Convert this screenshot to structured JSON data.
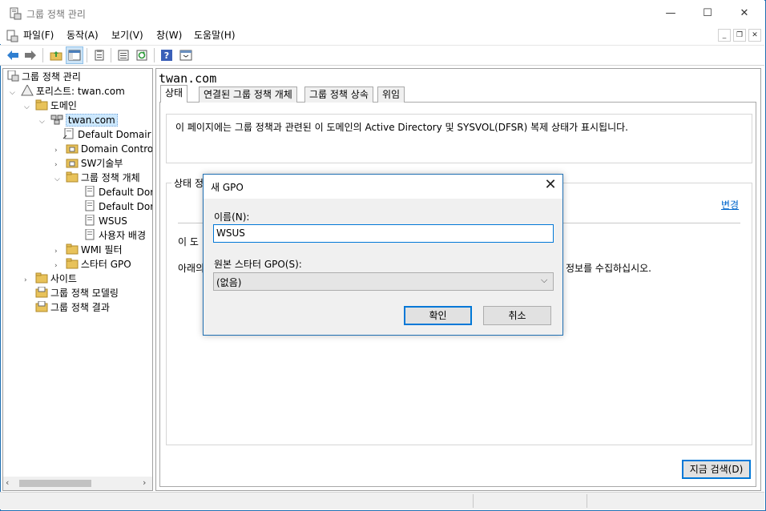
{
  "window": {
    "title": "그룹 정책 관리",
    "minimize": "—",
    "maximize": "☐",
    "close": "✕"
  },
  "menu": {
    "items": [
      "파일(F)",
      "동작(A)",
      "보기(V)",
      "창(W)",
      "도움말(H)"
    ]
  },
  "toolbar": {
    "icons": [
      "back-arrow-icon",
      "forward-arrow-icon",
      "up-folder-icon",
      "show-hide-tree-icon",
      "properties-icon",
      "export-list-icon",
      "refresh-icon",
      "help-icon",
      "console-icon"
    ]
  },
  "tree": {
    "root": "그룹 정책 관리",
    "forest": "포리스트: twan.com",
    "domains": "도메인",
    "domain": "twan.com",
    "default_domain_policy": "Default Domair",
    "domain_controllers": "Domain Contro",
    "sw_dept": "SW기술부",
    "gpo_container": "그룹 정책 개체",
    "gpo1": "Default Dor",
    "gpo2": "Default Dor",
    "gpo3": "WSUS",
    "gpo4": "사용자 배경",
    "wmi_filters": "WMI 필터",
    "starter_gpo": "스타터 GPO",
    "sites": "사이트",
    "modeling": "그룹 정책 모델링",
    "results": "그룹 정책 결과"
  },
  "main": {
    "title": "twan.com",
    "tabs": [
      "상태",
      "연결된 그룹 정책 개체",
      "그룹 정책 상속",
      "위임"
    ],
    "info": "이 페이지에는 그룹 정책과 관련된 이 도메인의 Active Directory 및 SYSVOL(DFSR) 복제 상태가 표시됩니다.",
    "status_legend": "상태 정",
    "change_link": "변경",
    "status_line1": "이 도",
    "status_line2": "아래의",
    "status_line2_tail": "정보를 수집하십시오.",
    "scan_button": "지금 검색(D)"
  },
  "dialog": {
    "title": "새 GPO",
    "name_label": "이름(N):",
    "name_value": "WSUS",
    "starter_label": "원본 스타터 GPO(S):",
    "starter_value": "(없음)",
    "ok": "확인",
    "cancel": "취소"
  }
}
